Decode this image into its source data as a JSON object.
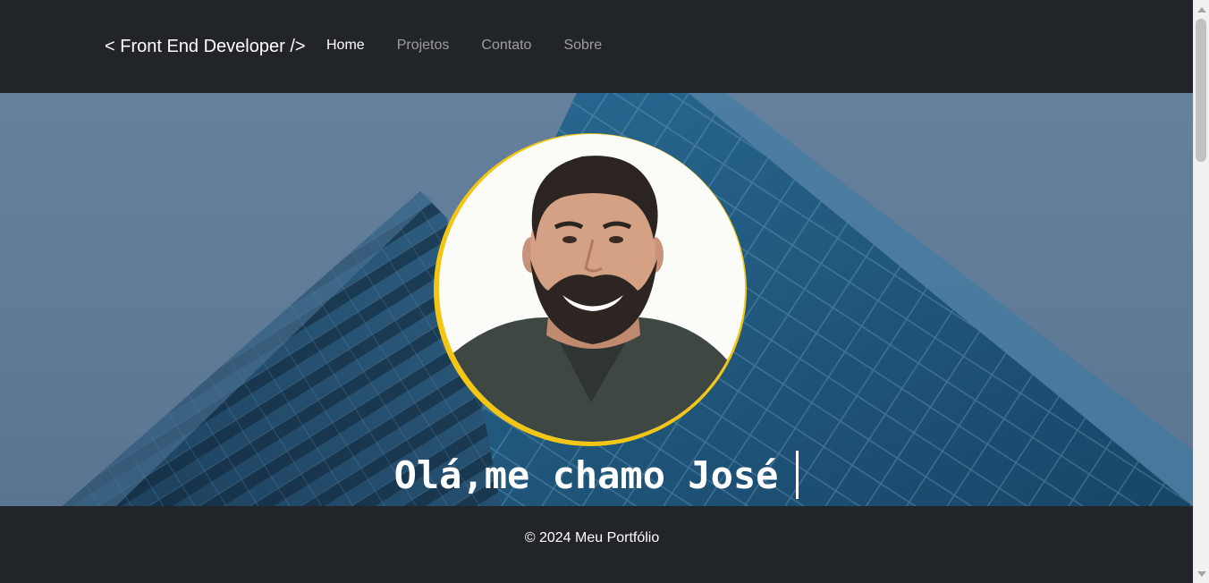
{
  "navbar": {
    "brand": "< Front End Developer />",
    "links": [
      {
        "label": "Home",
        "active": true
      },
      {
        "label": "Projetos",
        "active": false
      },
      {
        "label": "Contato",
        "active": false
      },
      {
        "label": "Sobre",
        "active": false
      }
    ]
  },
  "hero": {
    "headline": "Olá,me chamo José"
  },
  "footer": {
    "copyright": "© 2024 Meu Portfólio"
  },
  "colors": {
    "navbar_bg": "#212529",
    "avatar_ring": "#f3c613",
    "building": "#1f4e72",
    "sky": "#64809c"
  },
  "icons": {
    "scroll_up": "triangle-up",
    "scroll_down": "triangle-down"
  }
}
